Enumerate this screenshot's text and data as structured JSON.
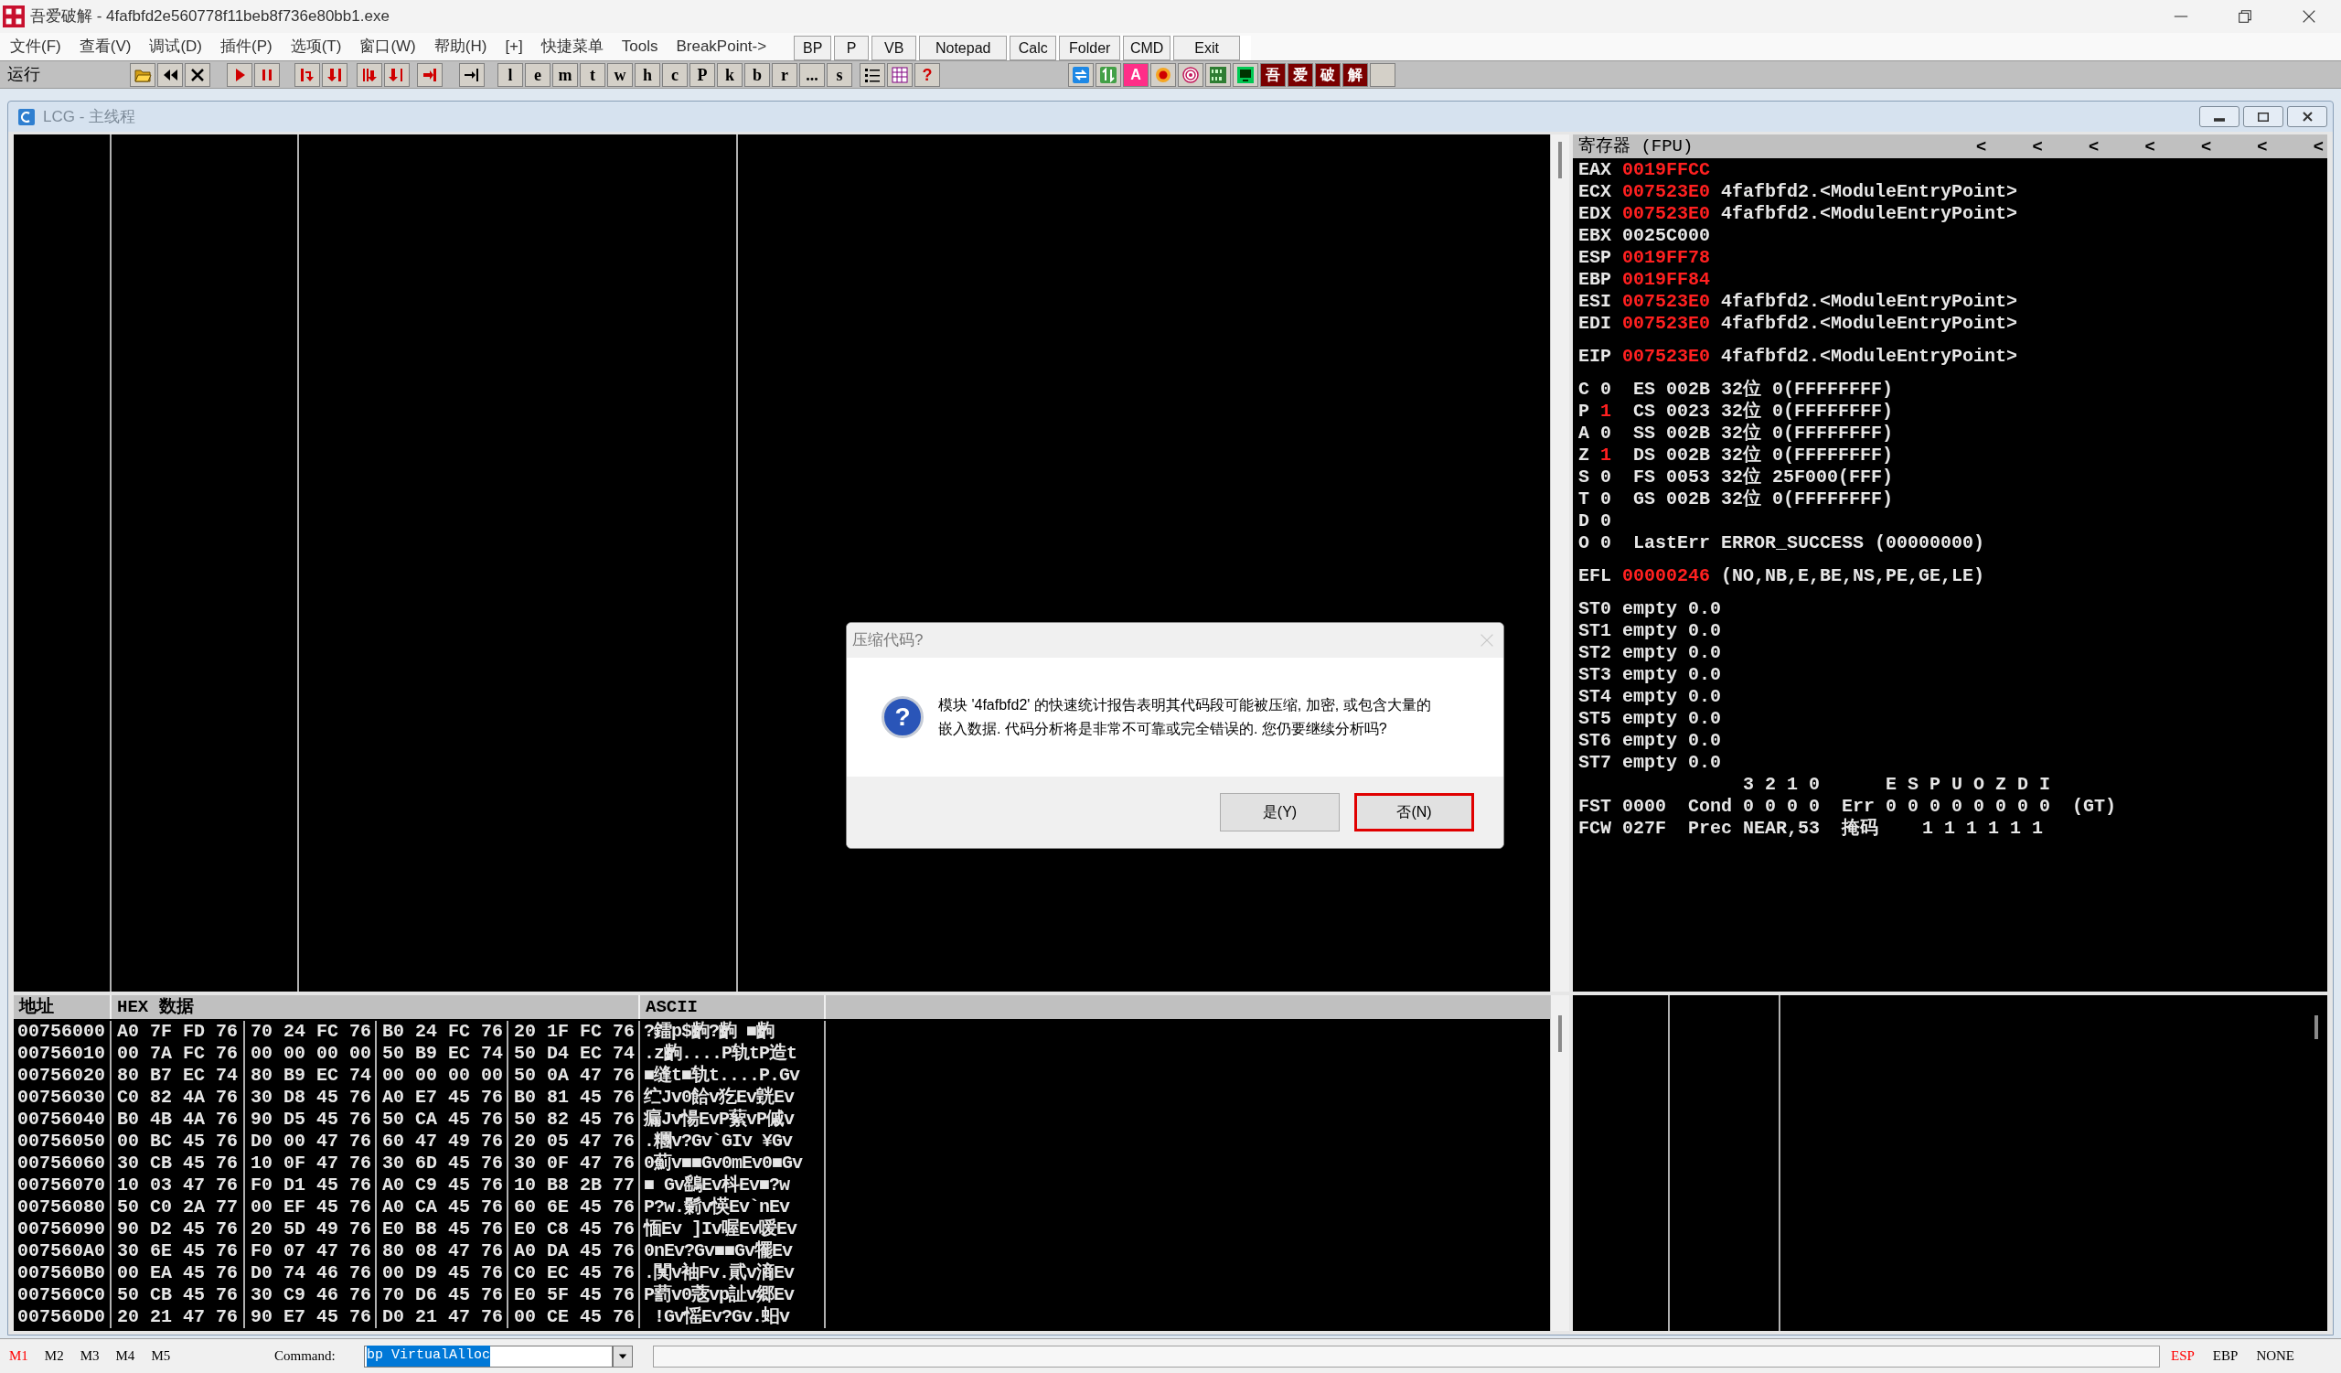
{
  "window": {
    "title": "吾爱破解 - 4fafbfd2e560778f11beb8f736e80bb1.exe"
  },
  "menu": [
    "文件(F)",
    "查看(V)",
    "调试(D)",
    "插件(P)",
    "选项(T)",
    "窗口(W)",
    "帮助(H)",
    "[+]",
    "快捷菜单",
    "Tools",
    "BreakPoint->"
  ],
  "tool_buttons": [
    "BP",
    "P",
    "VB",
    "Notepad",
    "Calc",
    "Folder",
    "CMD",
    "Exit"
  ],
  "toolbar": {
    "status": "运行",
    "letter_buttons": [
      "l",
      "e",
      "m",
      "t",
      "w",
      "h",
      "c",
      "P",
      "k",
      "b",
      "r",
      "...",
      "s"
    ],
    "help_button": "?",
    "font_button": "A",
    "brand_buttons": [
      "吾",
      "爱",
      "破",
      "解"
    ]
  },
  "child_window": {
    "title": "LCG - 主线程"
  },
  "registers": {
    "title": "寄存器 (FPU)",
    "arrows": [
      "<",
      "<",
      "<",
      "<",
      "<",
      "<",
      "<"
    ],
    "groups": [
      [
        {
          "kind": "register",
          "label": "EAX",
          "value": "0019FFCC",
          "changed": true
        },
        {
          "kind": "register",
          "label": "ECX",
          "value": "007523E0",
          "changed": true,
          "comment": "4fafbfd2.<ModuleEntryPoint>"
        },
        {
          "kind": "register",
          "label": "EDX",
          "value": "007523E0",
          "changed": true,
          "comment": "4fafbfd2.<ModuleEntryPoint>"
        },
        {
          "kind": "register",
          "label": "EBX",
          "value": "0025C000",
          "changed": false
        },
        {
          "kind": "register",
          "label": "ESP",
          "value": "0019FF78",
          "changed": true
        },
        {
          "kind": "register",
          "label": "EBP",
          "value": "0019FF84",
          "changed": true
        },
        {
          "kind": "register",
          "label": "ESI",
          "value": "007523E0",
          "changed": true,
          "comment": "4fafbfd2.<ModuleEntryPoint>"
        },
        {
          "kind": "register",
          "label": "EDI",
          "value": "007523E0",
          "changed": true,
          "comment": "4fafbfd2.<ModuleEntryPoint>"
        }
      ],
      [
        {
          "kind": "register",
          "label": "EIP",
          "value": "007523E0",
          "changed": true,
          "comment": "4fafbfd2.<ModuleEntryPoint>"
        }
      ],
      [
        {
          "kind": "flag",
          "label": "C",
          "value": "0",
          "changed": false,
          "comment": "ES 002B 32位 0(FFFFFFFF)"
        },
        {
          "kind": "flag",
          "label": "P",
          "value": "1",
          "changed": true,
          "comment": "CS 0023 32位 0(FFFFFFFF)"
        },
        {
          "kind": "flag",
          "label": "A",
          "value": "0",
          "changed": false,
          "comment": "SS 002B 32位 0(FFFFFFFF)"
        },
        {
          "kind": "flag",
          "label": "Z",
          "value": "1",
          "changed": true,
          "comment": "DS 002B 32位 0(FFFFFFFF)"
        },
        {
          "kind": "flag",
          "label": "S",
          "value": "0",
          "changed": false,
          "comment": "FS 0053 32位 25F000(FFF)"
        },
        {
          "kind": "flag",
          "label": "T",
          "value": "0",
          "changed": false,
          "comment": "GS 002B 32位 0(FFFFFFFF)"
        },
        {
          "kind": "flag",
          "label": "D",
          "value": "0",
          "changed": false
        },
        {
          "kind": "flag",
          "label": "O",
          "value": "0",
          "changed": false,
          "comment": "LastErr ERROR_SUCCESS (00000000)"
        }
      ],
      [
        {
          "kind": "register",
          "label": "EFL",
          "value": "00000246",
          "changed": true,
          "comment": "(NO,NB,E,BE,NS,PE,GE,LE)"
        }
      ],
      [
        {
          "kind": "register",
          "label": "ST0",
          "value": "empty",
          "changed": false,
          "comment": "0.0"
        },
        {
          "kind": "register",
          "label": "ST1",
          "value": "empty",
          "changed": false,
          "comment": "0.0"
        },
        {
          "kind": "register",
          "label": "ST2",
          "value": "empty",
          "changed": false,
          "comment": "0.0"
        },
        {
          "kind": "register",
          "label": "ST3",
          "value": "empty",
          "changed": false,
          "comment": "0.0"
        },
        {
          "kind": "register",
          "label": "ST4",
          "value": "empty",
          "changed": false,
          "comment": "0.0"
        },
        {
          "kind": "register",
          "label": "ST5",
          "value": "empty",
          "changed": false,
          "comment": "0.0"
        },
        {
          "kind": "register",
          "label": "ST6",
          "value": "empty",
          "changed": false,
          "comment": "0.0"
        },
        {
          "kind": "register",
          "label": "ST7",
          "value": "empty",
          "changed": false,
          "comment": "0.0"
        },
        {
          "kind": "bits",
          "text": "3 2 1 0      E S P U O Z D I"
        },
        {
          "kind": "text",
          "text": "FST 0000  Cond 0 0 0 0  Err 0 0 0 0 0 0 0 0  (GT)"
        },
        {
          "kind": "text",
          "text": "FCW 027F  Prec NEAR,53  掩码    1 1 1 1 1 1"
        }
      ]
    ]
  },
  "dump": {
    "columns": [
      "地址",
      "HEX 数据",
      "ASCII"
    ],
    "rows": [
      {
        "address": "00756000",
        "hex": [
          "A0 7F FD 76",
          "70 24 FC 76",
          "B0 24 FC 76",
          "20 1F FC 76"
        ],
        "ascii": "?鐳p$齣?齣 ■齣"
      },
      {
        "address": "00756010",
        "hex": [
          "00 7A FC 76",
          "00 00 00 00",
          "50 B9 EC 74",
          "50 D4 EC 74"
        ],
        "ascii": ".z齣....P轨tP造t"
      },
      {
        "address": "00756020",
        "hex": [
          "80 B7 EC 74",
          "80 B9 EC 74",
          "00 00 00 00",
          "50 0A 47 76"
        ],
        "ascii": "■缝t■轨t....P.Gv"
      },
      {
        "address": "00756030",
        "hex": [
          "C0 82 4A 76",
          "30 D8 45 76",
          "A0 E7 45 76",
          "B0 81 45 76"
        ],
        "ascii": "纻Jv0餄v犵Ev皝Ev"
      },
      {
        "address": "00756040",
        "hex": [
          "B0 4B 4A 76",
          "90 D5 45 76",
          "50 CA 45 76",
          "50 82 45 76"
        ],
        "ascii": "瘺Jv愓EvP蕠vP傶v"
      },
      {
        "address": "00756050",
        "hex": [
          "00 BC 45 76",
          "D0 00 47 76",
          "60 47 49 76",
          "20 05 47 76"
        ],
        "ascii": ".糰v?Gv`GIv ¥Gv"
      },
      {
        "address": "00756060",
        "hex": [
          "30 CB 45 76",
          "10 0F 47 76",
          "30 6D 45 76",
          "30 0F 47 76"
        ],
        "ascii": "0薊v■■Gv0mEv0■Gv"
      },
      {
        "address": "00756070",
        "hex": [
          "10 03 47 76",
          "F0 D1 45 76",
          "A0 C9 45 76",
          "10 B8 2B 77"
        ],
        "ascii": "■ Gv鷂Ev枓Ev■?w"
      },
      {
        "address": "00756080",
        "hex": [
          "50 C0 2A 77",
          "00 EF 45 76",
          "A0 CA 45 76",
          "60 6E 45 76"
        ],
        "ascii": "P?w.鬎v愥Ev`nEv"
      },
      {
        "address": "00756090",
        "hex": [
          "90 D2 45 76",
          "20 5D 49 76",
          "E0 B8 45 76",
          "E0 C8 45 76"
        ],
        "ascii": "愐Ev ]Iv喔Ev嗳Ev"
      },
      {
        "address": "007560A0",
        "hex": [
          "30 6E 45 76",
          "F0 07 47 76",
          "80 08 47 76",
          "A0 DA 45 76"
        ],
        "ascii": "0nEv?Gv■■Gv犤Ev"
      },
      {
        "address": "007560B0",
        "hex": [
          "00 EA 45 76",
          "D0 74 46 76",
          "00 D9 45 76",
          "C0 EC 45 76"
        ],
        "ascii": ".闃v袖Fv.貮v滳Ev"
      },
      {
        "address": "007560C0",
        "hex": [
          "50 CB 45 76",
          "30 C9 46 76",
          "70 D6 45 76",
          "E0 5F 45 76"
        ],
        "ascii": "P藅v0蔲vp訨v郷Ev"
      },
      {
        "address": "007560D0",
        "hex": [
          "20 21 47 76",
          "90 E7 45 76",
          "D0 21 47 76",
          "00 CE 45 76"
        ],
        "ascii": " !Gv愮Ev?Gv.蚎v"
      }
    ]
  },
  "status_bar": {
    "marks": [
      {
        "label": "M1",
        "selected": true
      },
      {
        "label": "M2",
        "selected": false
      },
      {
        "label": "M3",
        "selected": false
      },
      {
        "label": "M4",
        "selected": false
      },
      {
        "label": "M5",
        "selected": false
      }
    ],
    "command_label": "Command:",
    "command_value": "bp VirtualAlloc",
    "registers": [
      {
        "label": "ESP",
        "selected": true
      },
      {
        "label": "EBP",
        "selected": false
      },
      {
        "label": "NONE",
        "selected": false
      }
    ]
  },
  "dialog": {
    "title": "压缩代码?",
    "icon": "?",
    "message_lines": [
      "模块 '4fafbfd2' 的快速统计报告表明其代码段可能被压缩, 加密, 或包含大量的",
      "嵌入数据. 代码分析将是非常不可靠或完全错误的. 您仍要继续分析吗?"
    ],
    "buttons": [
      {
        "label": "是(Y)",
        "highlighted": false
      },
      {
        "label": "否(N)",
        "highlighted": true
      }
    ]
  }
}
